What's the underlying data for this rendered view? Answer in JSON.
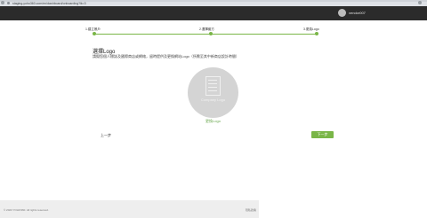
{
  "browser": {
    "url": "staging.yoho360.com/en/dashboard/onboarding?lk=3"
  },
  "header": {
    "username": "vendor007"
  },
  "stepper": {
    "steps": [
      "1.建立帳戶",
      "2.選擇套方",
      "3.更換Logo"
    ],
    "progress": 1
  },
  "main": {
    "title": "選擇Logo",
    "description": "請擬您個人標誌及國際商店或網絡，留時提供及更換網站Logo（所需至其中新商店設計時間）",
    "logo_placeholder": "Company Logo",
    "change_logo": "更換Logo",
    "back_label": "上一步",
    "next_label": "下一步"
  },
  "footer": {
    "copyright": "© 2023 YOHO360. All rights reserved.",
    "link": "隱私政策"
  },
  "colors": {
    "accent": "#7ab648",
    "header": "#2b2b2b"
  }
}
